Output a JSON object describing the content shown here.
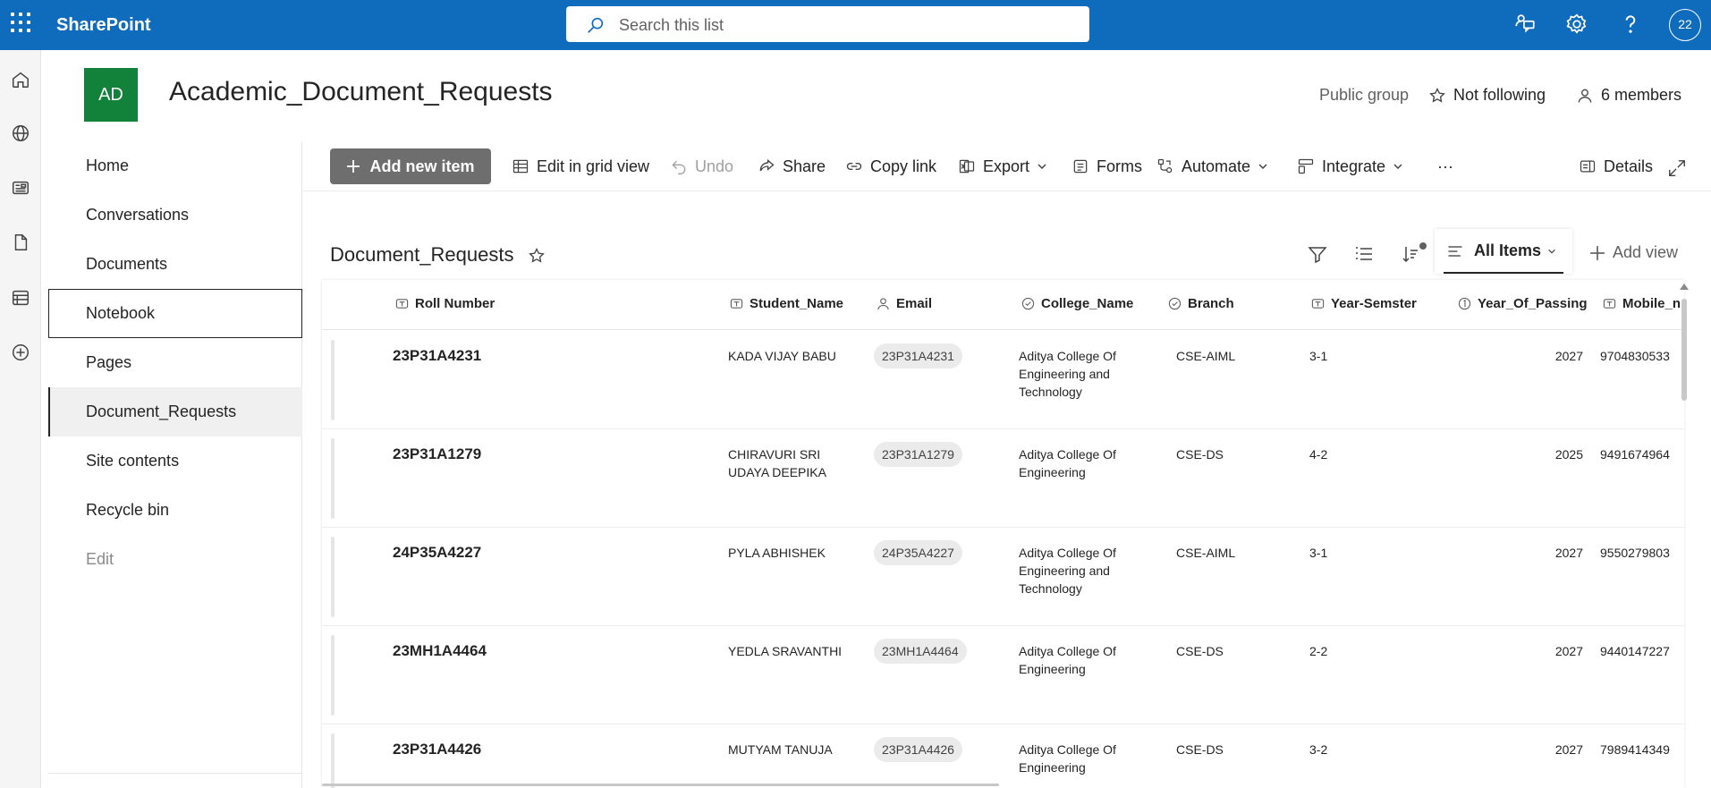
{
  "suite": {
    "app_name": "SharePoint",
    "search_placeholder": "Search this list",
    "avatar_text": "22"
  },
  "site": {
    "logo_text": "AD",
    "title": "Academic_Document_Requests",
    "group_type": "Public group",
    "follow_label": "Not following",
    "members_label": "6 members"
  },
  "nav": {
    "items": [
      {
        "label": "Home"
      },
      {
        "label": "Conversations"
      },
      {
        "label": "Documents"
      },
      {
        "label": "Notebook"
      },
      {
        "label": "Pages"
      },
      {
        "label": "Document_Requests"
      },
      {
        "label": "Site contents"
      },
      {
        "label": "Recycle bin"
      },
      {
        "label": "Edit"
      }
    ]
  },
  "commands": {
    "add_new_item": "Add new item",
    "edit_grid": "Edit in grid view",
    "undo": "Undo",
    "share": "Share",
    "copy_link": "Copy link",
    "export": "Export",
    "forms": "Forms",
    "automate": "Automate",
    "integrate": "Integrate",
    "more": "···",
    "details": "Details"
  },
  "list": {
    "title": "Document_Requests",
    "view_name": "All Items",
    "add_view": "Add view",
    "columns": [
      "Roll Number",
      "Student_Name",
      "Email",
      "College_Name",
      "Branch",
      "Year-Semster",
      "Year_Of_Passing",
      "Mobile_n"
    ],
    "rows": [
      {
        "roll": "23P31A4231",
        "name": [
          "KADA VIJAY BABU"
        ],
        "email": "23P31A4231",
        "college": [
          "Aditya College Of",
          "Engineering and",
          "Technology"
        ],
        "branch": "CSE-AIML",
        "year_sem": "3-1",
        "passing": "2027",
        "mobile": "9704830533"
      },
      {
        "roll": "23P31A1279",
        "name": [
          "CHIRAVURI SRI",
          "UDAYA DEEPIKA"
        ],
        "email": "23P31A1279",
        "college": [
          "Aditya College Of",
          "Engineering"
        ],
        "branch": "CSE-DS",
        "year_sem": "4-2",
        "passing": "2025",
        "mobile": "9491674964"
      },
      {
        "roll": "24P35A4227",
        "name": [
          "PYLA ABHISHEK"
        ],
        "email": "24P35A4227",
        "college": [
          "Aditya College Of",
          "Engineering and",
          "Technology"
        ],
        "branch": "CSE-AIML",
        "year_sem": "3-1",
        "passing": "2027",
        "mobile": "9550279803"
      },
      {
        "roll": "23MH1A4464",
        "name": [
          "YEDLA SRAVANTHI"
        ],
        "email": "23MH1A4464",
        "college": [
          "Aditya College Of",
          "Engineering"
        ],
        "branch": "CSE-DS",
        "year_sem": "2-2",
        "passing": "2027",
        "mobile": "9440147227"
      },
      {
        "roll": "23P31A4426",
        "name": [
          "MUTYAM TANUJA"
        ],
        "email": "23P31A4426",
        "college": [
          "Aditya College Of",
          "Engineering"
        ],
        "branch": "CSE-DS",
        "year_sem": "3-2",
        "passing": "2027",
        "mobile": "7989414349"
      }
    ]
  },
  "colors": {
    "suite_bar": "#0f6cbd",
    "site_logo": "#12823b",
    "primary_button": "#6e6e6e"
  }
}
